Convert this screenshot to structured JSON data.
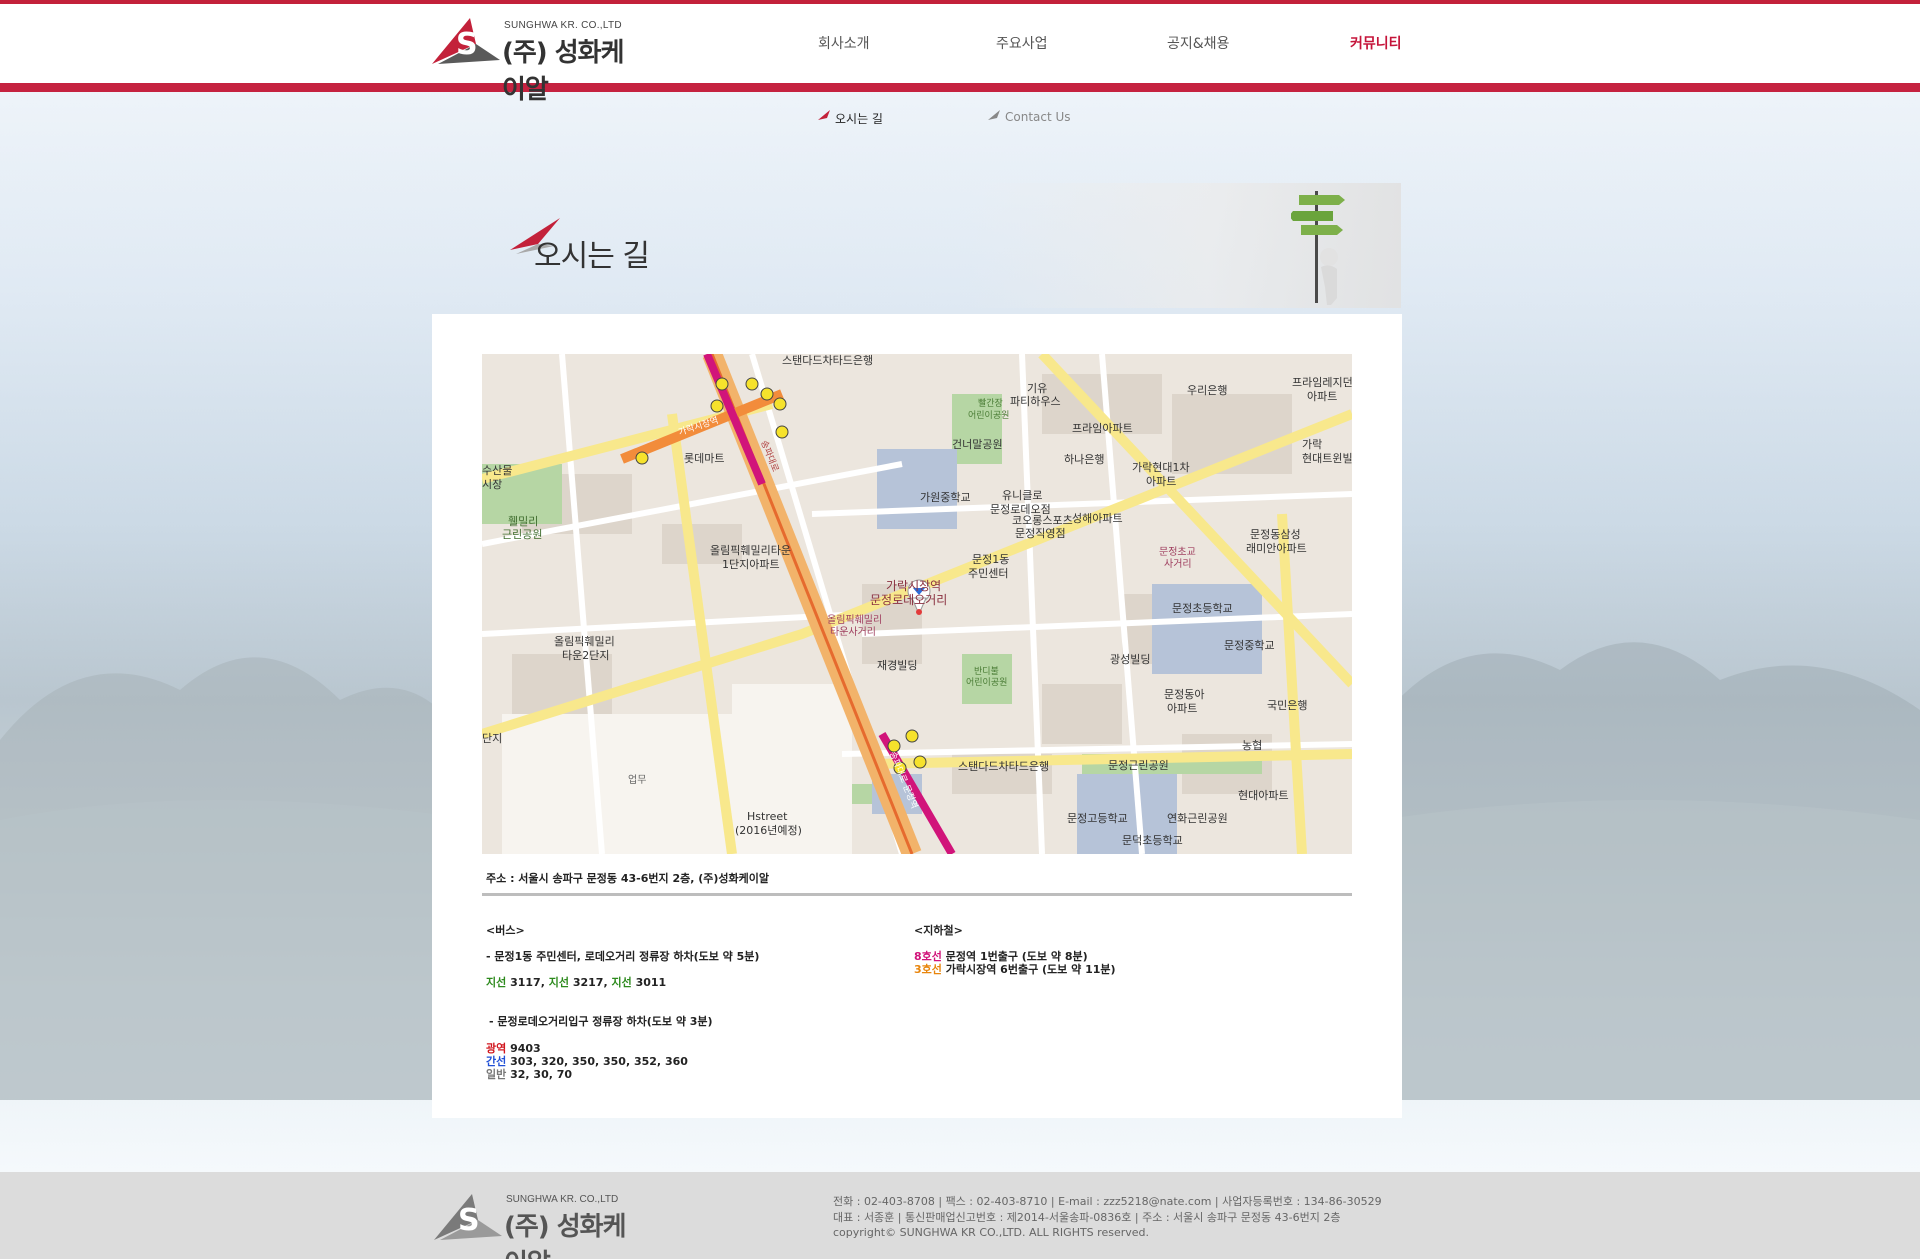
{
  "brand": {
    "name_en": "SUNGHWA KR. CO.,LTD",
    "name_ko": "(주) 성화케이알",
    "logo_colors": {
      "red": "#c3213a",
      "gray": "#5a5a5a"
    }
  },
  "nav": {
    "items": [
      {
        "label": "회사소개"
      },
      {
        "label": "주요사업"
      },
      {
        "label": "공지&채용"
      },
      {
        "label": "커뮤니티"
      }
    ],
    "active_color": "#c5143a"
  },
  "subnav": {
    "items": [
      {
        "label": "오시는 길"
      },
      {
        "label": "Contact Us"
      }
    ]
  },
  "page": {
    "title": "오시는 길"
  },
  "map": {
    "labels": [
      "스탠다드차타드은행",
      "파티하우스",
      "기유",
      "우리은행",
      "프라임레지던",
      "아파트",
      "빨간장",
      "어린이공원",
      "프라임아파트",
      "건너말공원",
      "하나은행",
      "가락현대1차",
      "가락",
      "현대트윈빌",
      "아파트",
      "롯데마트",
      "가원중학교",
      "유니클로",
      "문정로데오점",
      "코오롱스포츠",
      "성해아파트",
      "문정직영점",
      "문정동삼성",
      "래미안아파트",
      "문정초교",
      "사거리",
      "휄밀리",
      "근린공원",
      "올림픽훼밀리타운",
      "1단지아파트",
      "문정1동",
      "주민센터",
      "문정초등학교",
      "문정중학교",
      "올림픽훼밀리",
      "타운사거리",
      "올림픽훼밀리",
      "타운2단지",
      "재경빌딩",
      "광성빌딩",
      "반디불",
      "어린이공원",
      "문정동아",
      "아파트",
      "국민은행",
      "농협",
      "단지",
      "업무",
      "스탠다드차타드은행",
      "문정근린공원",
      "현대아파트",
      "Hstreet",
      "(2016년예정)",
      "문정고등학교",
      "연화근린공원",
      "문덕초등학교",
      "수산물",
      "시장",
      "가락시장역",
      "문정로데오거리",
      "송파대로",
      "문정로"
    ],
    "roads": [
      "가락시장역",
      "송파대로",
      "송파대로 문정역"
    ]
  },
  "address": "주소 : 서울시 송파구 문정동 43-6번지 2층, (주)성화케이알",
  "bus": {
    "heading": "<버스>",
    "stop1": "- 문정1동 주민센터, 로데오거리 정류장 하차(도보 약 5분)",
    "stop1_routes": [
      {
        "type": "지선",
        "num": "3117,"
      },
      {
        "type": "지선",
        "num": "3217,"
      },
      {
        "type": "지선",
        "num": "3011"
      }
    ],
    "stop2": "- 문정로데오거리입구 정류장 하차(도보 약 3분)",
    "stop2_routes": [
      {
        "type": "광역",
        "nums": "9403"
      },
      {
        "type": "간선",
        "nums": "303, 320, 350, 350, 352, 360"
      },
      {
        "type": "일반",
        "nums": "32, 30, 70"
      }
    ]
  },
  "subway": {
    "heading": "<지하철>",
    "lines": [
      {
        "line": "8호선",
        "text": "문정역 1번출구 (도보 약 8분)"
      },
      {
        "line": "3호선",
        "text": "가락시장역 6번출구 (도보 약 11분)"
      }
    ]
  },
  "colors": {
    "branch_bus": "#2c8a1c",
    "express_bus": "#d1161e",
    "trunk_bus": "#1f4fd6",
    "general_bus": "#777777",
    "line8": "#d1147a",
    "line3": "#e8850c"
  },
  "footer": {
    "line1": "전화 : 02-403-8708  |  팩스 : 02-403-8710  |  E-mail : zzz5218@nate.com  | 사업자등록번호 : 134-86-30529",
    "line2": "대표 : 서종훈  |  통신판매업신고번호 : 제2014-서울송파-0836호  |  주소 : 서울시 송파구 문정동 43-6번지 2층",
    "line3": "copyright© SUNGHWA KR CO.,LTD. ALL RIGHTS reserved."
  }
}
